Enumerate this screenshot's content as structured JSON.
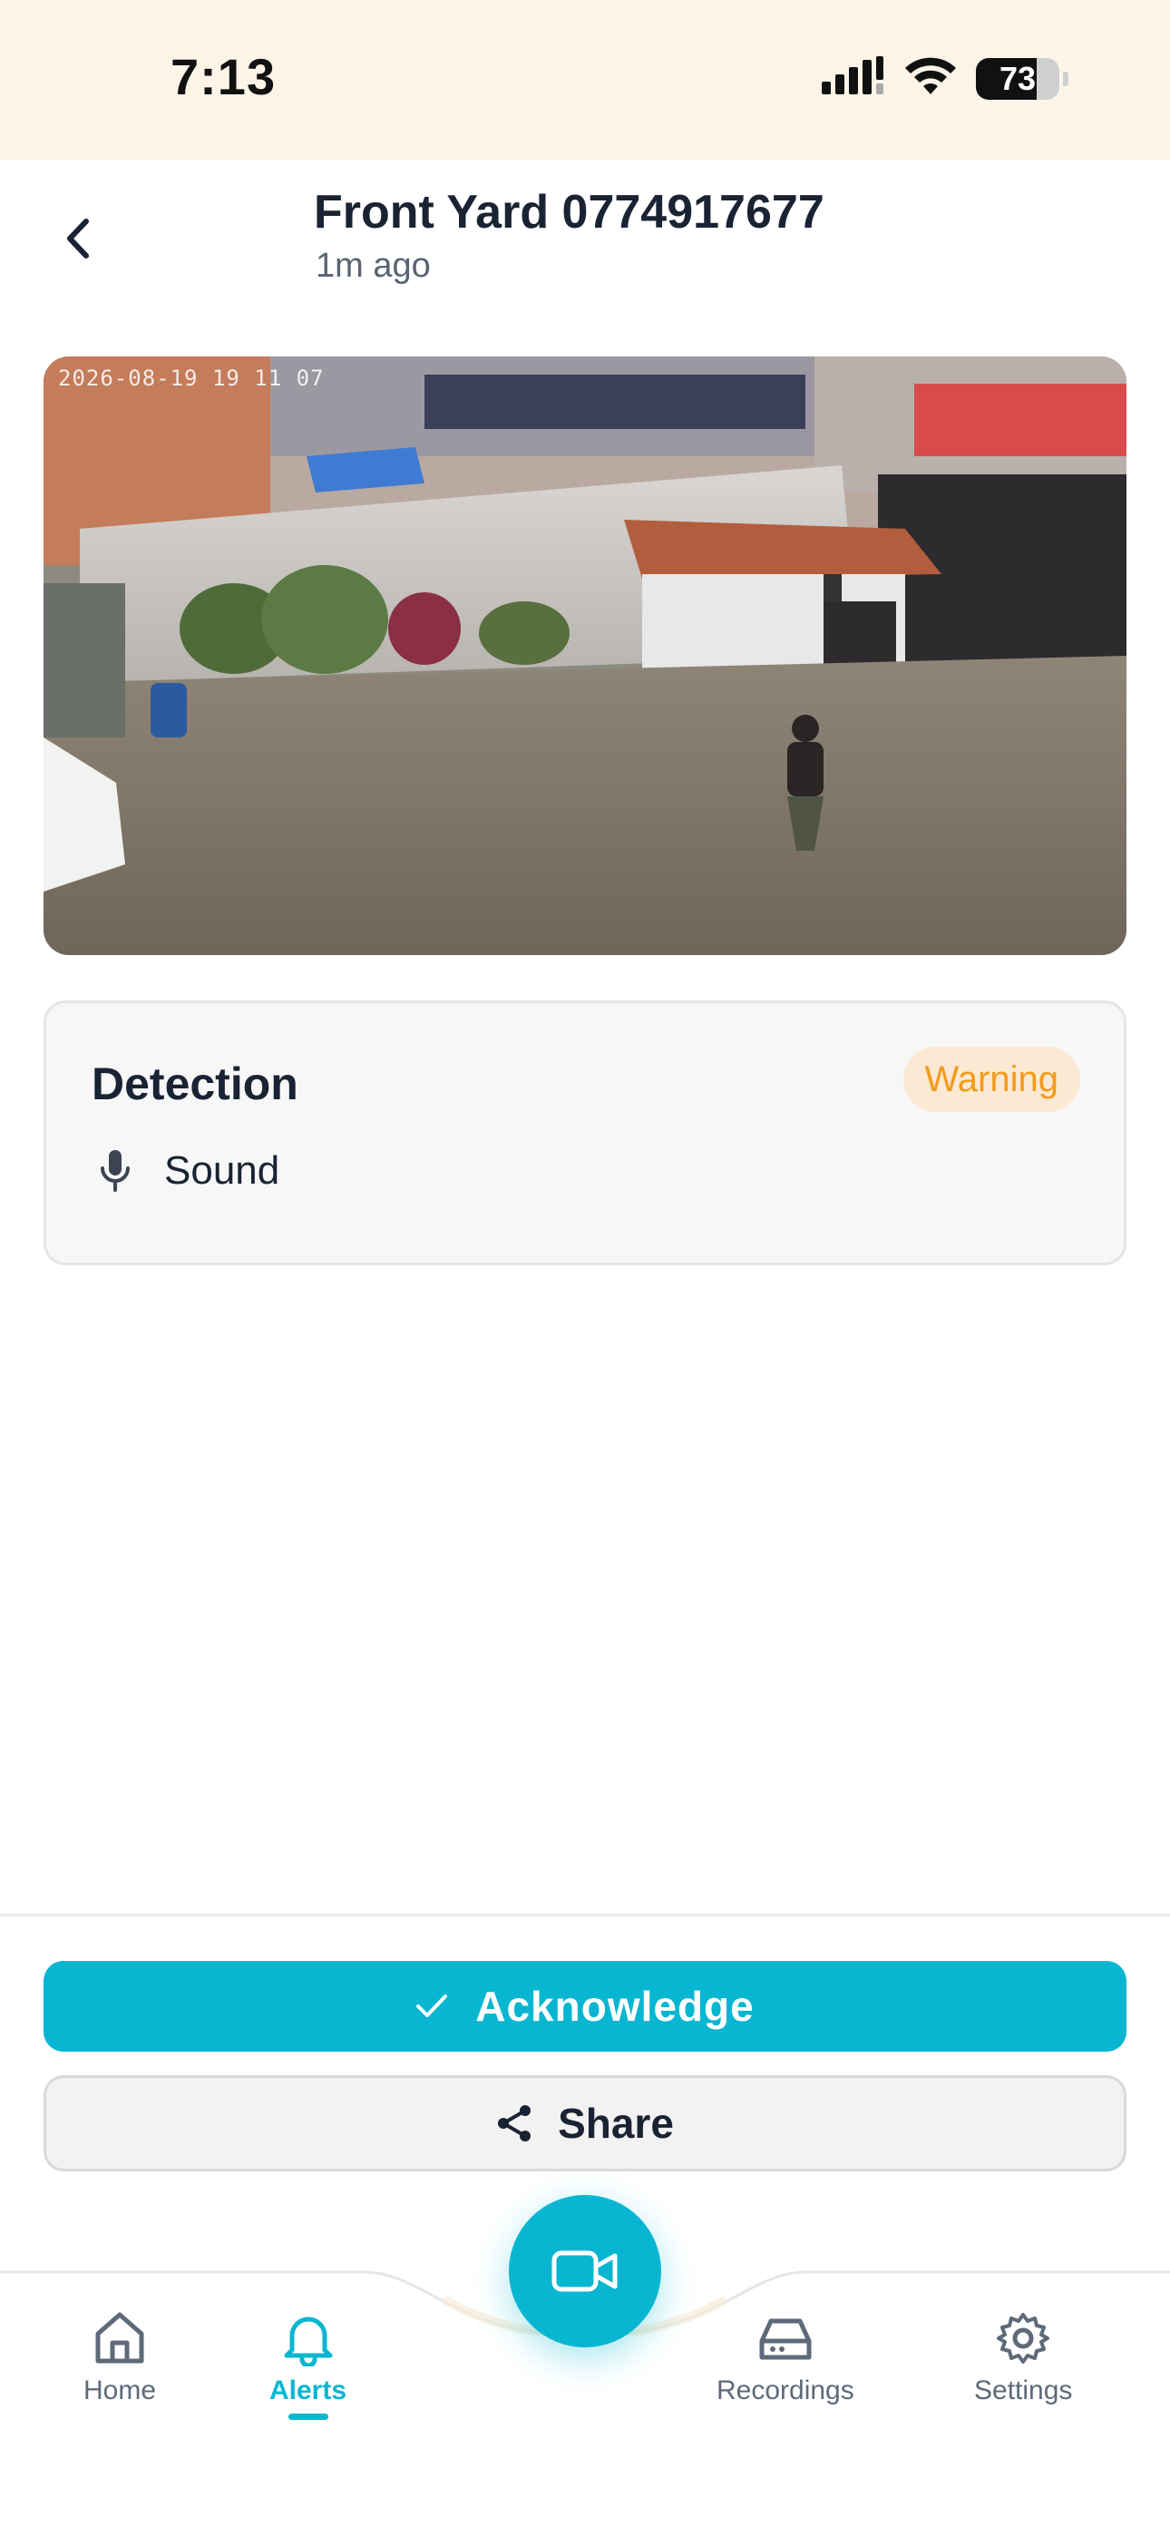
{
  "status_bar": {
    "time": "7:13",
    "battery": "73"
  },
  "header": {
    "title": "Front Yard 0774917677",
    "subtitle": "1m ago"
  },
  "snapshot": {
    "timestamp": "2026-08-19 19 11 07"
  },
  "detection": {
    "title": "Detection",
    "badge": "Warning",
    "type_label": "Sound",
    "type_icon": "microphone-icon"
  },
  "actions": {
    "acknowledge_label": "Acknowledge",
    "share_label": "Share"
  },
  "nav": {
    "items": [
      {
        "label": "Home",
        "icon": "home-icon"
      },
      {
        "label": "Alerts",
        "icon": "bell-icon"
      },
      {
        "label": "Recordings",
        "icon": "hard-drive-icon"
      },
      {
        "label": "Settings",
        "icon": "gear-icon"
      }
    ],
    "fab_icon": "video-camera-icon"
  },
  "colors": {
    "accent": "#08b6d1",
    "warning_text": "#f29b1b",
    "warning_bg": "#fbe9d3",
    "status_bar_bg": "#fdf4e8"
  }
}
